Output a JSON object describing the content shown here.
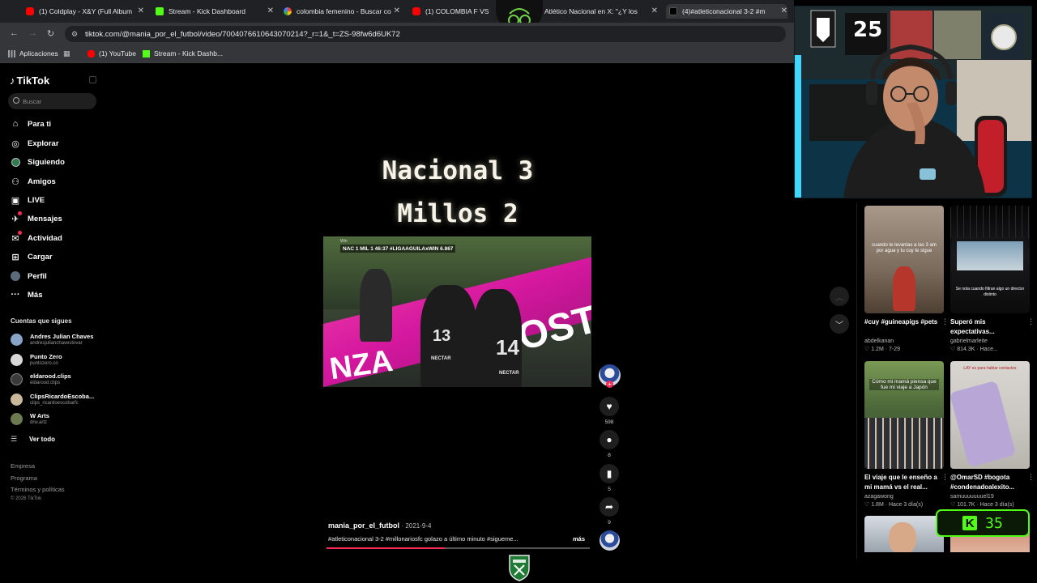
{
  "browser": {
    "tabs": [
      {
        "label": "(1) Coldplay - X&Y (Full Album",
        "icon": "youtube-icon"
      },
      {
        "label": "Stream - Kick Dashboard",
        "icon": "kick-icon"
      },
      {
        "label": "colombia femenino - Buscar co",
        "icon": "google-icon"
      },
      {
        "label": "(1) COLOMBIA F VS M",
        "icon": "youtube-icon"
      },
      {
        "label": "Atlético Nacional en X: \"¿Y los",
        "icon": "x-icon"
      },
      {
        "label": "(4)#atleticonacional 3-2 #m",
        "icon": "tiktok-icon"
      }
    ],
    "url": "tiktok.com/@mania_por_el_futbol/video/7004076610643070214?_r=1&_t=ZS-98fw6d6UK72",
    "bookmarks": [
      {
        "label": "Aplicaciones",
        "icon": "apps-grid-icon"
      },
      {
        "label": "(1) YouTube",
        "icon": "youtube-icon"
      },
      {
        "label": "Stream - Kick Dashb...",
        "icon": "kick-icon"
      }
    ]
  },
  "sidebar": {
    "logo": "TikTok",
    "search_placeholder": "Buscar",
    "nav": [
      {
        "label": "Para ti",
        "icon": "home-icon"
      },
      {
        "label": "Explorar",
        "icon": "compass-icon"
      },
      {
        "label": "Siguiendo",
        "icon": "following-icon"
      },
      {
        "label": "Amigos",
        "icon": "friends-icon"
      },
      {
        "label": "LIVE",
        "icon": "live-icon"
      },
      {
        "label": "Mensajes",
        "icon": "messages-icon"
      },
      {
        "label": "Actividad",
        "icon": "activity-icon"
      },
      {
        "label": "Cargar",
        "icon": "upload-icon"
      },
      {
        "label": "Perfil",
        "icon": "profile-icon"
      },
      {
        "label": "Más",
        "icon": "more-icon"
      }
    ],
    "following_title": "Cuentas que sigues",
    "accounts": [
      {
        "name": "Andres Julian Chaves",
        "handle": "andresjulianchavestovar",
        "color": "#8aa4c8"
      },
      {
        "name": "Punto Zero",
        "handle": "puntozero.co",
        "color": "#d8d8d8"
      },
      {
        "name": "eldarood.clips",
        "handle": "eldarood.clips",
        "color": "#3a3a3a"
      },
      {
        "name": "ClipsRicardoEscoba...",
        "handle": "clips_ricardoescobarfc",
        "color": "#c9b89a"
      },
      {
        "name": "W Arts",
        "handle": "drw.artz",
        "color": "#6d7a4f"
      }
    ],
    "see_all": "Ver todo",
    "footer": [
      "Empresa",
      "Programa",
      "Términos y políticas"
    ],
    "copyright": "© 2026 TikTok"
  },
  "video": {
    "overlay_line1": "Nacional 3",
    "overlay_line2": "Millos 2",
    "scorebug": "NAC 1  MIL 1  46:37   #LIGAAGUILAxWIN 6.867",
    "watermark": "Win",
    "jersey_13": "13",
    "jersey_14": "14",
    "sponsor": "NECTAR",
    "ad_text": "NZA",
    "ad_text2": "OST",
    "author": "mania_por_el_futbol",
    "date": "· 2021-9-4",
    "description": "#atleticonacional 3-2 #millonariosfc  golazo a último minuto #sigueme...",
    "more": "más",
    "progress": 0.45
  },
  "actions": {
    "likes": "598",
    "comments": "8",
    "saves": "5",
    "shares": "9"
  },
  "recommendations": [
    {
      "caption": "#cuy #guineapigs #pets",
      "user": "abdelkanan",
      "stats": "♡ 1.2M · 7-29",
      "thumb_text": "cuando te levantas a las 3 am por agua y tu cuy te sigue",
      "bg": "#6b5a4c"
    },
    {
      "caption": "Superó mis expectativas...",
      "user": "gabrielmarleite",
      "stats": "♡ 814.3K · Hace...",
      "thumb_text": "Se nota cuando filtran algo un director distinto",
      "bg": "#1c1c22"
    },
    {
      "caption": "El viaje que le enseño a mi mamá vs el real...",
      "user": "azagawong",
      "stats": "♡ 1.8M · Hace 3 día(s)",
      "thumb_text": "Cómo mi mamá piensa que fue mi viaje a Japón",
      "bg": "#4f6b3b"
    },
    {
      "caption": "@OmarSD #bogota #condenadoalexito...",
      "user": "samuuuuuuuel19",
      "stats": "♡ 101.7K · Hace 3 día(s)",
      "thumb_text": "LAY es para hablar contactos",
      "bg": "#c9c6c2"
    }
  ],
  "kick_badge": {
    "count": "35"
  },
  "colors": {
    "accent": "#fe2c55",
    "kick": "#53fc18"
  }
}
